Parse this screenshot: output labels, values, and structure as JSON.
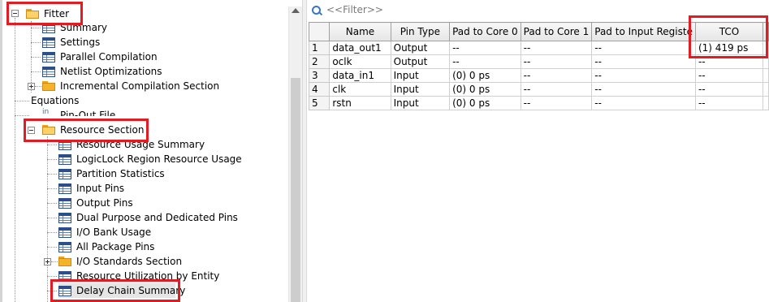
{
  "tree": {
    "fitter": {
      "label": "Fitter"
    },
    "items": [
      {
        "label": "Summary",
        "icon": "table-icon"
      },
      {
        "label": "Settings",
        "icon": "table-icon"
      },
      {
        "label": "Parallel Compilation",
        "icon": "table-icon"
      },
      {
        "label": "Netlist Optimizations",
        "icon": "table-icon"
      },
      {
        "label": "Incremental Compilation Section",
        "icon": "folder-icon"
      },
      {
        "label": "Equations",
        "icon": "equations-icon"
      },
      {
        "label": "Pin-Out File",
        "icon": "pinout-icon"
      }
    ],
    "resource": {
      "label": "Resource Section"
    },
    "resource_items": [
      {
        "label": "Resource Usage Summary",
        "icon": "table-icon"
      },
      {
        "label": "LogicLock Region Resource Usage",
        "icon": "table-icon"
      },
      {
        "label": "Partition Statistics",
        "icon": "table-icon"
      },
      {
        "label": "Input Pins",
        "icon": "table-icon"
      },
      {
        "label": "Output Pins",
        "icon": "table-icon"
      },
      {
        "label": "Dual Purpose and Dedicated Pins",
        "icon": "table-icon"
      },
      {
        "label": "I/O Bank Usage",
        "icon": "table-icon"
      },
      {
        "label": "All Package Pins",
        "icon": "table-icon"
      },
      {
        "label": "I/O Standards Section",
        "icon": "folder-icon"
      },
      {
        "label": "Resource Utilization by Entity",
        "icon": "table-icon"
      },
      {
        "label": "Delay Chain Summary",
        "icon": "table-icon"
      }
    ]
  },
  "filter": {
    "placeholder": "<<Filter>>"
  },
  "table": {
    "columns": [
      "Name",
      "Pin Type",
      "Pad to Core 0",
      "Pad to Core 1",
      "Pad to Input Registe",
      "TCO"
    ],
    "rows": [
      {
        "n": "1",
        "cells": [
          "data_out1",
          "Output",
          "--",
          "--",
          "--",
          "(1) 419 ps"
        ]
      },
      {
        "n": "2",
        "cells": [
          "oclk",
          "Output",
          "--",
          "--",
          "--",
          "--"
        ]
      },
      {
        "n": "3",
        "cells": [
          "data_in1",
          "Input",
          "(0) 0 ps",
          "--",
          "--",
          "--"
        ]
      },
      {
        "n": "4",
        "cells": [
          "clk",
          "Input",
          "(0) 0 ps",
          "--",
          "--",
          "--"
        ]
      },
      {
        "n": "5",
        "cells": [
          "rstn",
          "Input",
          "(0) 0 ps",
          "--",
          "--",
          "--"
        ]
      }
    ]
  },
  "colors": {
    "highlight": "#e31b23",
    "table_icon": "#2c4f8c",
    "folder": "#f5b22b"
  }
}
